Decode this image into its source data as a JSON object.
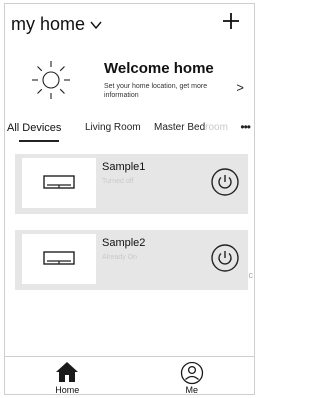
{
  "header": {
    "home_label": "my home",
    "chevron_icon": "chevron-down-icon",
    "add_icon": "plus-icon"
  },
  "welcome": {
    "icon": "sun-icon",
    "title": "Welcome home",
    "subtitle": "Set your home location, get more information",
    "arrow": ">"
  },
  "tabs": [
    {
      "label": "All Devices",
      "active": true
    },
    {
      "label": "Living Room",
      "active": false
    },
    {
      "label": "Master Bed",
      "faded_suffix": "room",
      "active": false
    }
  ],
  "tabs_more": "•••",
  "devices": [
    {
      "name": "Sample1",
      "status": "Turned off",
      "icon": "air-conditioner-icon",
      "power_icon": "power-icon"
    },
    {
      "name": "Sample2",
      "status": "Already On",
      "icon": "air-conditioner-icon",
      "power_icon": "power-icon"
    }
  ],
  "edge_mark": "c",
  "bottom_nav": [
    {
      "label": "Home",
      "icon": "home-icon",
      "active": true
    },
    {
      "label": "Me",
      "icon": "profile-icon",
      "active": false
    }
  ],
  "colors": {
    "card_bg": "#e6e6e6",
    "status_text": "#c9c9c9",
    "border": "#cfcfcf"
  }
}
